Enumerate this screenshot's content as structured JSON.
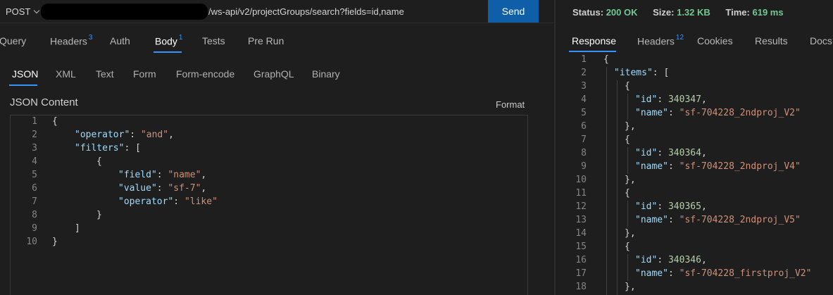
{
  "request": {
    "method": "POST",
    "url_visible": "/ws-api/v2/projectGroups/search?fields=id,name",
    "send_label": "Send"
  },
  "request_tabs": [
    {
      "label": "Query",
      "badge": ""
    },
    {
      "label": "Headers",
      "badge": "3"
    },
    {
      "label": "Auth",
      "badge": ""
    },
    {
      "label": "Body",
      "badge": "1"
    },
    {
      "label": "Tests",
      "badge": ""
    },
    {
      "label": "Pre Run",
      "badge": ""
    }
  ],
  "body_tabs": [
    "JSON",
    "XML",
    "Text",
    "Form",
    "Form-encode",
    "GraphQL",
    "Binary"
  ],
  "body": {
    "label": "JSON Content",
    "format_label": "Format",
    "line_numbers": [
      "1",
      "2",
      "3",
      "4",
      "5",
      "6",
      "7",
      "8",
      "9",
      "10"
    ]
  },
  "response_status": {
    "status_label": "Status:",
    "status_value": "200 OK",
    "size_label": "Size:",
    "size_value": "1.32 KB",
    "time_label": "Time:",
    "time_value": "619 ms"
  },
  "response_tabs": [
    {
      "label": "Response",
      "badge": ""
    },
    {
      "label": "Headers",
      "badge": "12"
    },
    {
      "label": "Cookies",
      "badge": ""
    },
    {
      "label": "Results",
      "badge": ""
    },
    {
      "label": "Docs",
      "badge": ""
    }
  ],
  "response_line_numbers": [
    "1",
    "2",
    "3",
    "4",
    "5",
    "6",
    "7",
    "8",
    "9",
    "10",
    "11",
    "12",
    "13",
    "14",
    "15",
    "16",
    "17",
    "18"
  ],
  "request_json": {
    "operator_key": "\"operator\"",
    "operator_val": "\"and\"",
    "filters_key": "\"filters\"",
    "field_key": "\"field\"",
    "field_val": "\"name\"",
    "value_key": "\"value\"",
    "value_val": "\"sf-7\"",
    "op2_key": "\"operator\"",
    "op2_val": "\"like\""
  },
  "response_json": {
    "items_key": "\"items\"",
    "id_key": "\"id\"",
    "name_key": "\"name\"",
    "items": [
      {
        "id": "340347",
        "name": "\"sf-704228_2ndproj_V2\""
      },
      {
        "id": "340364",
        "name": "\"sf-704228_2ndproj_V4\""
      },
      {
        "id": "340365",
        "name": "\"sf-704228_2ndproj_V5\""
      },
      {
        "id": "340346",
        "name": "\"sf-704228_firstproj_V2\""
      }
    ]
  },
  "colors": {
    "accent": "#3794ff",
    "send_button": "#0e5fa8",
    "status_ok": "#73c991",
    "json_key": "#9cdcfe",
    "json_string": "#ce9178",
    "json_number": "#b5cea8"
  }
}
